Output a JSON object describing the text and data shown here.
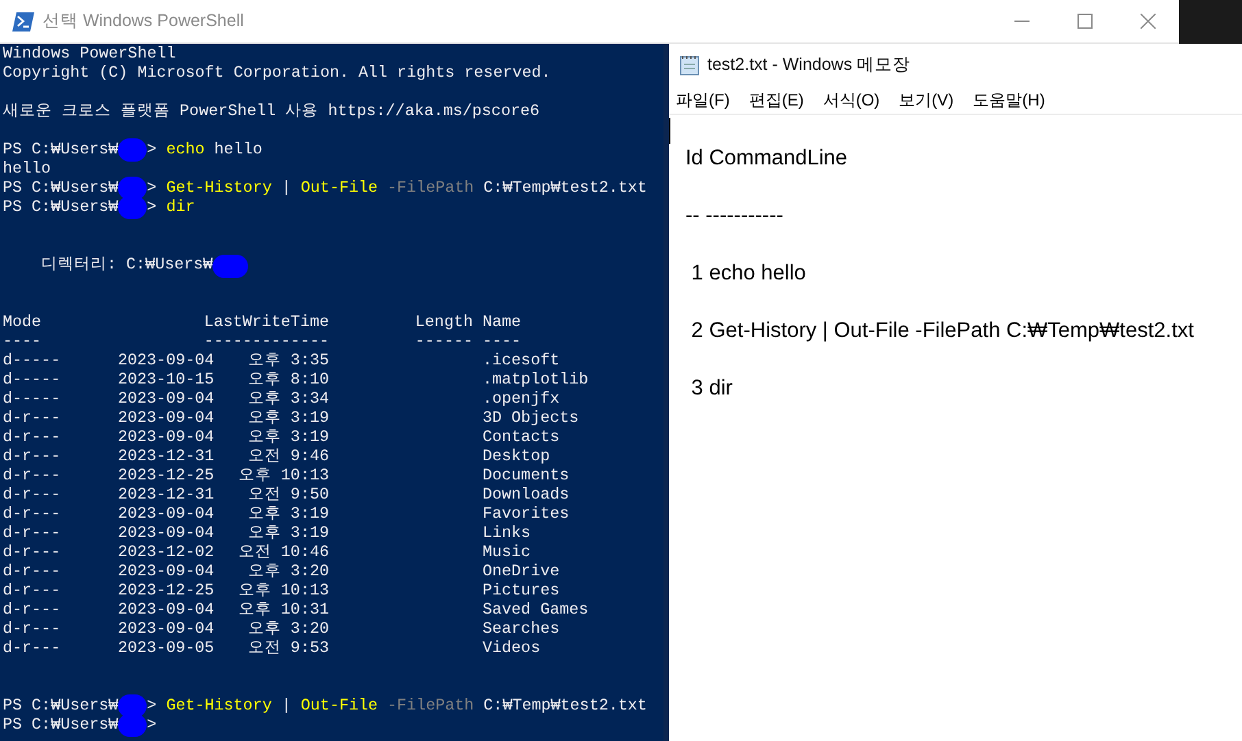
{
  "powershell": {
    "title": "선택 Windows PowerShell",
    "blocks": [
      {
        "lines": [
          [
            {
              "text": "Windows PowerShell",
              "kind": "plain"
            }
          ],
          [
            {
              "text": "Copyright (C) Microsoft Corporation. All rights reserved.",
              "kind": "plain"
            }
          ]
        ]
      },
      {
        "lines": [
          [
            {
              "text": "새로운 크로스 플랫폼 PowerShell 사용 https://aka.ms/pscore6",
              "kind": "plain"
            }
          ]
        ]
      },
      {
        "lines": [
          [
            {
              "text": "PS C:₩Users₩",
              "kind": "plain"
            },
            {
              "kind": "redacted"
            },
            {
              "text": "> ",
              "kind": "plain"
            },
            {
              "text": "echo",
              "kind": "command"
            },
            {
              "text": " hello",
              "kind": "plain"
            }
          ],
          [
            {
              "text": "hello",
              "kind": "plain"
            }
          ],
          [
            {
              "text": "PS C:₩Users₩",
              "kind": "plain"
            },
            {
              "kind": "redacted"
            },
            {
              "text": "> ",
              "kind": "plain"
            },
            {
              "text": "Get-History",
              "kind": "command"
            },
            {
              "text": " | ",
              "kind": "plain"
            },
            {
              "text": "Out-File",
              "kind": "command"
            },
            {
              "text": " -FilePath",
              "kind": "parameter"
            },
            {
              "text": " C:₩Temp₩test2.txt",
              "kind": "plain"
            }
          ],
          [
            {
              "text": "PS C:₩Users₩",
              "kind": "plain"
            },
            {
              "kind": "redacted"
            },
            {
              "text": "> ",
              "kind": "plain"
            },
            {
              "text": "dir",
              "kind": "command"
            }
          ]
        ]
      }
    ],
    "directory": {
      "heading": "디렉터리: C:₩Users₩",
      "columns": [
        {
          "label": "Mode",
          "rule": "----"
        },
        {
          "label": "LastWriteTime",
          "rule": "-------------"
        },
        {
          "label": "Length",
          "rule": "------"
        },
        {
          "label": "Name",
          "rule": "----"
        }
      ],
      "rows": [
        {
          "mode": "d-----",
          "date": "2023-09-04",
          "time": "오후 3:35",
          "name": ".icesoft"
        },
        {
          "mode": "d-----",
          "date": "2023-10-15",
          "time": "오후 8:10",
          "name": ".matplotlib"
        },
        {
          "mode": "d-----",
          "date": "2023-09-04",
          "time": "오후 3:34",
          "name": ".openjfx"
        },
        {
          "mode": "d-r---",
          "date": "2023-09-04",
          "time": "오후 3:19",
          "name": "3D Objects"
        },
        {
          "mode": "d-r---",
          "date": "2023-09-04",
          "time": "오후 3:19",
          "name": "Contacts"
        },
        {
          "mode": "d-r---",
          "date": "2023-12-31",
          "time": "오전 9:46",
          "name": "Desktop"
        },
        {
          "mode": "d-r---",
          "date": "2023-12-25",
          "time": "오후 10:13",
          "name": "Documents"
        },
        {
          "mode": "d-r---",
          "date": "2023-12-31",
          "time": "오전 9:50",
          "name": "Downloads"
        },
        {
          "mode": "d-r---",
          "date": "2023-09-04",
          "time": "오후 3:19",
          "name": "Favorites"
        },
        {
          "mode": "d-r---",
          "date": "2023-09-04",
          "time": "오후 3:19",
          "name": "Links"
        },
        {
          "mode": "d-r---",
          "date": "2023-12-02",
          "time": "오전 10:46",
          "name": "Music"
        },
        {
          "mode": "d-r---",
          "date": "2023-09-04",
          "time": "오후 3:20",
          "name": "OneDrive"
        },
        {
          "mode": "d-r---",
          "date": "2023-12-25",
          "time": "오후 10:13",
          "name": "Pictures"
        },
        {
          "mode": "d-r---",
          "date": "2023-09-04",
          "time": "오후 10:31",
          "name": "Saved Games"
        },
        {
          "mode": "d-r---",
          "date": "2023-09-04",
          "time": "오후 3:20",
          "name": "Searches"
        },
        {
          "mode": "d-r---",
          "date": "2023-09-05",
          "time": "오전 9:53",
          "name": "Videos"
        }
      ]
    },
    "final_lines": [
      [
        {
          "text": "PS C:₩Users₩",
          "kind": "plain"
        },
        {
          "kind": "redacted"
        },
        {
          "text": "> ",
          "kind": "plain"
        },
        {
          "text": "Get-History",
          "kind": "command"
        },
        {
          "text": " | ",
          "kind": "plain"
        },
        {
          "text": "Out-File",
          "kind": "command"
        },
        {
          "text": " -FilePath",
          "kind": "parameter"
        },
        {
          "text": " C:₩Temp₩test2.txt",
          "kind": "plain"
        }
      ],
      [
        {
          "text": "PS C:₩Users₩",
          "kind": "plain"
        },
        {
          "kind": "redacted"
        },
        {
          "text": ">",
          "kind": "plain"
        }
      ]
    ]
  },
  "notepad": {
    "title": "test2.txt - Windows 메모장",
    "menu": [
      "파일(F)",
      "편집(E)",
      "서식(O)",
      "보기(V)",
      "도움말(H)"
    ],
    "lines": [
      "Id CommandLine",
      "-- -----------",
      " 1 echo hello",
      " 2 Get-History | Out-File -FilePath C:₩Temp₩test2.txt",
      " 3 dir"
    ]
  }
}
